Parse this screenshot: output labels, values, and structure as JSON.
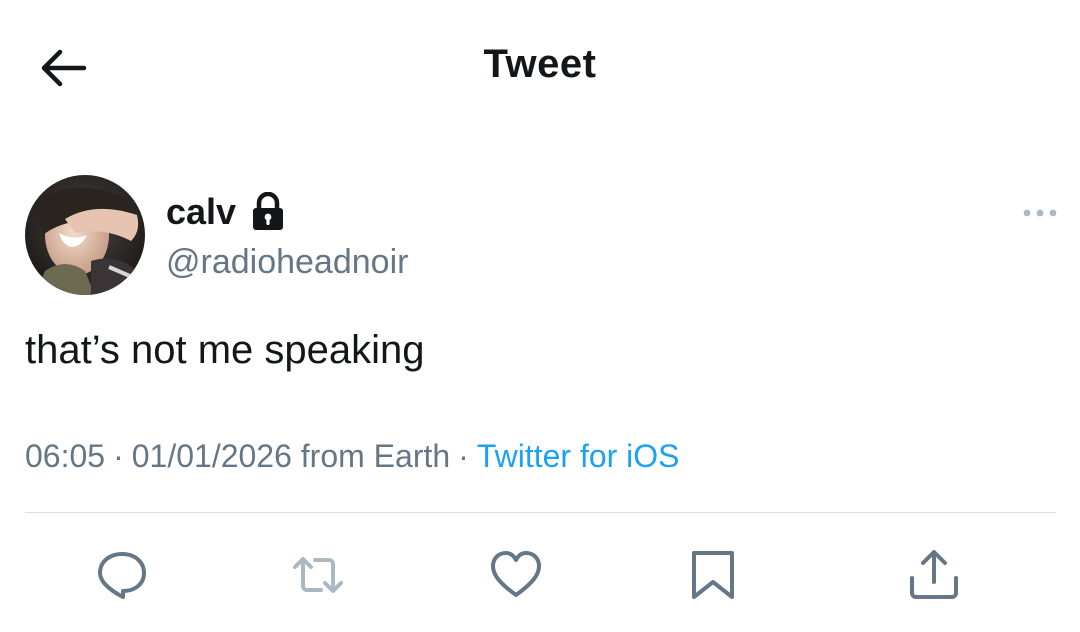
{
  "header": {
    "title": "Tweet",
    "back_icon": "arrow-left-icon"
  },
  "tweet": {
    "author": {
      "display_name": "calv",
      "handle": "@radioheadnoir",
      "protected_icon": "lock-icon"
    },
    "more_icon": "more-horizontal-icon",
    "text": "that’s not me speaking",
    "time": "06:05",
    "date": "01/01/2026",
    "location": "from Earth",
    "separator": "·",
    "client": "Twitter for iOS"
  },
  "actions": [
    {
      "icon": "reply-icon"
    },
    {
      "icon": "retweet-icon"
    },
    {
      "icon": "like-icon"
    },
    {
      "icon": "bookmark-icon"
    },
    {
      "icon": "share-icon"
    }
  ],
  "colors": {
    "text": "#14171a",
    "secondary": "#657786",
    "link": "#1da1f2",
    "divider": "#d9dde0"
  }
}
